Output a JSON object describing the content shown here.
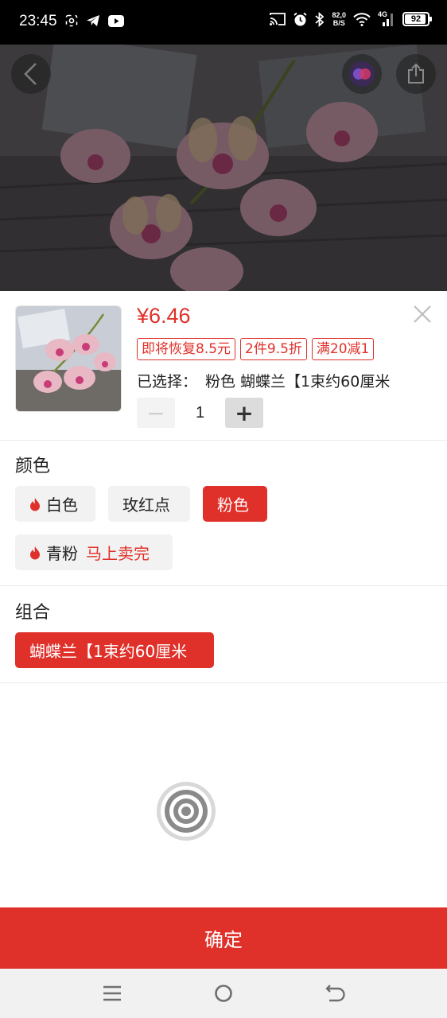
{
  "status_bar": {
    "time": "23:45",
    "net_speed_value": "82,0",
    "net_speed_unit": "B/S",
    "network_type": "4G",
    "battery_level": "92",
    "battery_fraction": 0.92
  },
  "product": {
    "price": "¥6.46",
    "promos": [
      "即将恢复8.5元",
      "2件9.5折",
      "满20减1"
    ],
    "selected_label": "已选择：",
    "selected_value": "粉色 蝴蝶兰【1束约60厘米",
    "quantity": "1",
    "qty_minus": "−",
    "qty_plus": "+"
  },
  "color_section": {
    "title": "颜色",
    "options": [
      {
        "label": "白色",
        "hot": true,
        "selected": false
      },
      {
        "label": "玫红点",
        "hot": false,
        "selected": false
      },
      {
        "label": "粉色",
        "hot": false,
        "selected": true
      },
      {
        "label": "青粉",
        "hot": true,
        "selected": false,
        "note": "马上卖完"
      }
    ]
  },
  "combo_section": {
    "title": "组合",
    "options": [
      {
        "label": "蝴蝶兰【1束约60厘米",
        "selected": true
      }
    ]
  },
  "confirm_button": "确定",
  "colors": {
    "accent": "#e0302a",
    "chip_bg": "#f2f2f2",
    "nav_bg": "#f1f1f1"
  },
  "icons": [
    "back-icon",
    "cast-icon",
    "share-icon",
    "close-icon",
    "flame-icon",
    "assistive-touch-icon",
    "menu-icon",
    "home-icon",
    "back-nav-icon"
  ]
}
